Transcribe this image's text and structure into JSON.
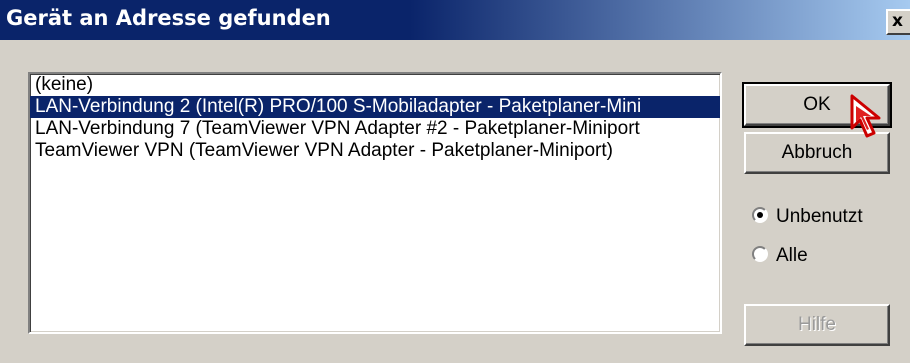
{
  "dialog": {
    "title": "Gerät an Adresse gefunden",
    "close_label": "x"
  },
  "adapter_list": {
    "items": [
      {
        "label": "(keine)",
        "selected": false
      },
      {
        "label": "LAN-Verbindung 2 (Intel(R) PRO/100 S-Mobiladapter - Paketplaner-Mini",
        "selected": true
      },
      {
        "label": "LAN-Verbindung 7 (TeamViewer VPN Adapter #2 - Paketplaner-Miniport",
        "selected": false
      },
      {
        "label": "TeamViewer VPN (TeamViewer VPN Adapter - Paketplaner-Miniport)",
        "selected": false
      }
    ]
  },
  "buttons": {
    "ok_label": "OK",
    "cancel_label": "Abbruch",
    "help_label": "Hilfe"
  },
  "filter": {
    "options": [
      {
        "label": "Unbenutzt",
        "checked": true
      },
      {
        "label": "Alle",
        "checked": false
      }
    ]
  },
  "colors": {
    "title_bar": "#0a246a",
    "selection": "#0a246a",
    "face": "#d4d0c8"
  },
  "icons": [
    "close-icon",
    "mouse-pointer-icon"
  ]
}
